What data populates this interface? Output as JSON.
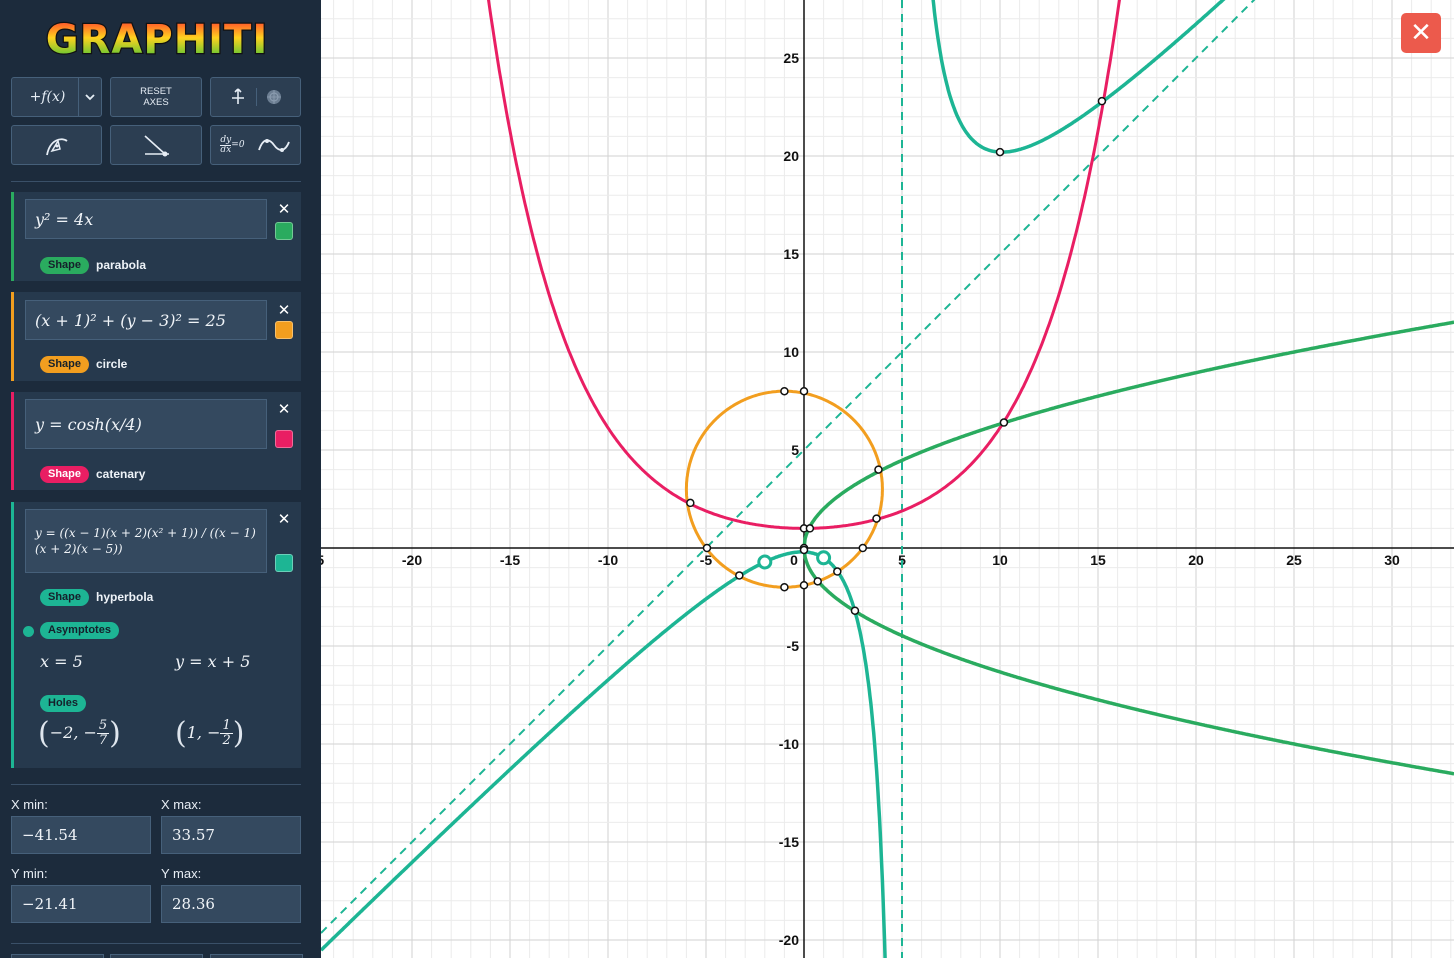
{
  "app": {
    "name": "GRAPHITI"
  },
  "toolbar": {
    "fx_label": "+f(x)",
    "reset_axes_line1": "RESET",
    "reset_axes_line2": "AXES",
    "derivative_label": "=0"
  },
  "functions": [
    {
      "equation": "y² = 4x",
      "shape_badge": "Shape",
      "shape": "parabola",
      "color": "#2aab5f"
    },
    {
      "equation": "(x + 1)² + (y − 3)² = 25",
      "shape_badge": "Shape",
      "shape": "circle",
      "color": "#f29e1f"
    },
    {
      "equation": "y = cosh(x/4)",
      "shape_badge": "Shape",
      "shape": "catenary",
      "color": "#e91e63"
    },
    {
      "equation": "y = ((x − 1)(x + 2)(x² + 1)) / ((x − 1)(x + 2)(x − 5))",
      "shape_badge": "Shape",
      "shape": "hyperbola",
      "color": "#1db594",
      "asymptotes_badge": "Asymptotes",
      "asymptotes": [
        "x = 5",
        "y = x + 5"
      ],
      "holes_badge": "Holes",
      "holes": [
        {
          "x": "−2",
          "y_num": "5",
          "y_den": "7"
        },
        {
          "x": "1",
          "y_num": "1",
          "y_den": "2"
        }
      ]
    }
  ],
  "axes_fields": {
    "x_min_label": "X min:",
    "x_min": "−41.54",
    "x_max_label": "X max:",
    "x_max": "33.57",
    "y_min_label": "Y min:",
    "y_min": "−21.41",
    "y_max_label": "Y max:",
    "y_max": "28.36"
  },
  "graph": {
    "x_ticks": [
      "-25",
      "-20",
      "-15",
      "-10",
      "-5",
      "0",
      "5",
      "10",
      "15",
      "20",
      "25",
      "30"
    ],
    "y_ticks": [
      "25",
      "20",
      "15",
      "10",
      "5",
      "-5",
      "-10",
      "-15",
      "-20"
    ],
    "colors": {
      "parabola": "#2aab5f",
      "circle": "#f29e1f",
      "catenary": "#e91e63",
      "hyperbola": "#1db594",
      "grid_minor": "#ebebeb",
      "grid_major": "#d2d2d2",
      "axis": "#111111"
    }
  },
  "close_icon": "close-icon"
}
